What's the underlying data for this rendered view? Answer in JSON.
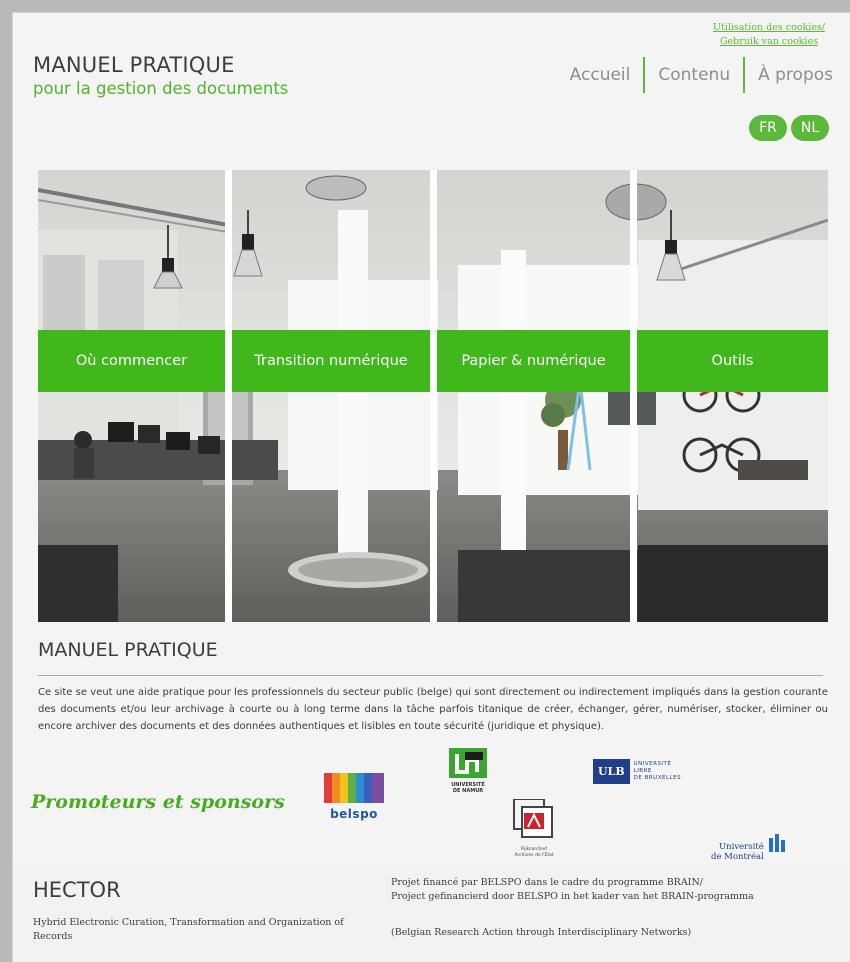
{
  "header": {
    "cookies_fr": "Utilisation des cookies/",
    "cookies_nl": "Gebruik van cookies",
    "title": "MANUEL PRATIQUE",
    "subtitle": "pour la gestion des documents"
  },
  "nav": [
    {
      "label": "Accueil"
    },
    {
      "label": "Contenu"
    },
    {
      "label": "À propos"
    }
  ],
  "languages": [
    {
      "label": "FR"
    },
    {
      "label": "NL"
    }
  ],
  "tiles": [
    {
      "label": "Où commencer"
    },
    {
      "label": "Transition numérique"
    },
    {
      "label": "Papier & numérique"
    },
    {
      "label": "Outils"
    }
  ],
  "main": {
    "section_title": "MANUEL PRATIQUE",
    "intro": "Ce site se veut une aide pratique pour les professionnels du secteur public (belge) qui sont directement ou indirectement impliqués dans la gestion courante des documents et/ou leur archivage à courte ou à long terme dans la tâche parfois titanique de créer, échanger, gérer, numériser, stocker, éliminer ou encore archiver des documents et des données authentiques et lisibles en toute sécurité (juridique et physique)."
  },
  "sponsors": {
    "title": "Promoteurs et sponsors",
    "belspo": "belspo",
    "namur": [
      "UNIVERSITÉ",
      "DE NAMUR"
    ],
    "ulb_mark": "ULB",
    "ulb_text": [
      "UNIVERSITÉ",
      "LIBRE",
      "DE BRUXELLES"
    ],
    "arch": [
      "Rijksarchief",
      "Archives de l'État"
    ],
    "montreal": [
      "Université",
      "de Montréal"
    ]
  },
  "footer": {
    "hector": "HECTOR",
    "hector_full": "Hybrid Electronic Curation, Transformation  and Organization of Records",
    "funding_fr": "Projet financé par BELSPO dans le cadre du programme BRAIN/",
    "funding_nl": "Project gefinancierd door BELSPO in het kader van het BRAIN-programma",
    "brain": "(Belgian Research Action through Interdisciplinary Networks)"
  },
  "colors": {
    "accent": "#40b81c",
    "text": "#3d3d3d"
  }
}
